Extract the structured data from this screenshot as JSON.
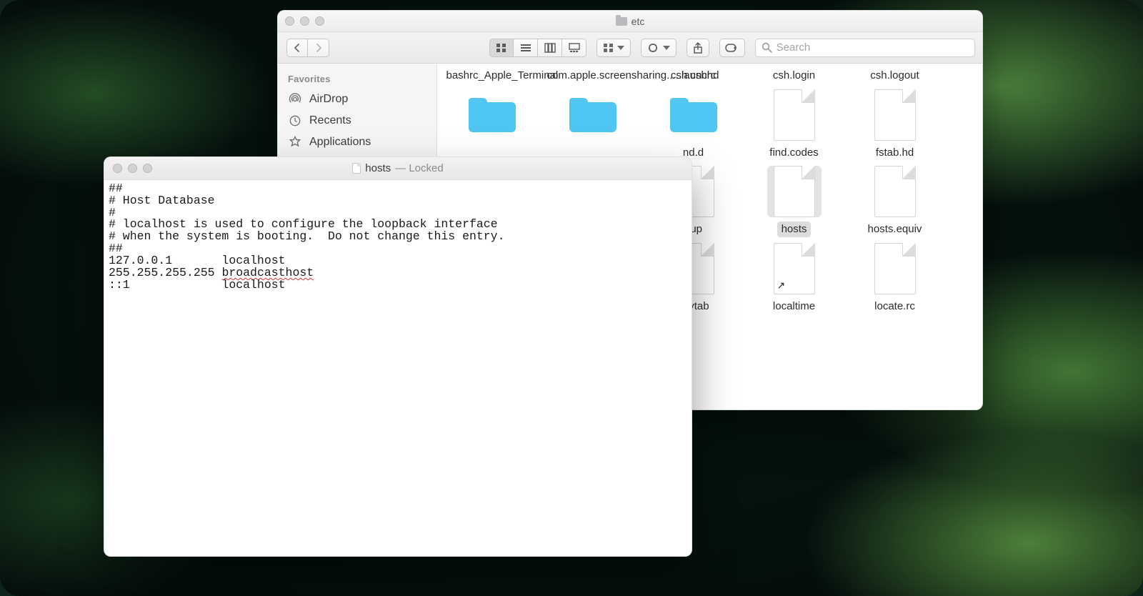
{
  "finder": {
    "folder_name": "etc",
    "search_placeholder": "Search",
    "sidebar_header": "Favorites",
    "sidebar": [
      {
        "label": "AirDrop"
      },
      {
        "label": "Recents"
      },
      {
        "label": "Applications"
      }
    ],
    "row0": [
      "bashrc_Apple_Terminal",
      "com.apple.screensharing.....launchd",
      "csh.cshrc",
      "csh.login",
      "csh.logout"
    ],
    "row1": [
      "",
      "",
      "nd.d",
      "find.codes",
      "fstab.hd"
    ],
    "row2": [
      "",
      "",
      "oup",
      "hosts",
      "hosts.equiv"
    ],
    "row3": [
      "",
      "",
      "keytab",
      "localtime",
      "locate.rc"
    ]
  },
  "textedit": {
    "filename": "hosts",
    "status": "Locked",
    "content_lines": [
      "##",
      "# Host Database",
      "#",
      "# localhost is used to configure the loopback interface",
      "# when the system is booting.  Do not change this entry.",
      "##",
      "127.0.0.1       localhost",
      "255.255.255.255 ",
      "::1             localhost"
    ],
    "broadcast_word": "broadcasthost"
  }
}
